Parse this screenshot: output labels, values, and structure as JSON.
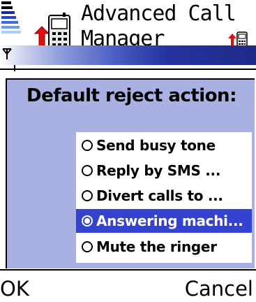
{
  "status": {
    "signal_icon": "signal-strength-icon",
    "antenna_icon": "antenna-icon"
  },
  "header": {
    "title_line1": "Advanced Call",
    "title_line2": "Manager",
    "app_icon": "phone-with-arrow-icon",
    "small_icon": "phone-with-arrow-icon"
  },
  "dialog": {
    "title": "Default reject action:",
    "options": [
      {
        "label": "Send busy tone",
        "selected": false
      },
      {
        "label": "Reply by SMS ...",
        "selected": false
      },
      {
        "label": "Divert calls to ...",
        "selected": false
      },
      {
        "label": "Answering machi...",
        "selected": true
      },
      {
        "label": "Mute the ringer",
        "selected": false
      }
    ]
  },
  "softkeys": {
    "left": "OK",
    "right": "Cancel"
  },
  "colors": {
    "selection": "#3343cf",
    "dialog_bg": "#a9b1e2",
    "header_bar": "#1e2a88"
  }
}
